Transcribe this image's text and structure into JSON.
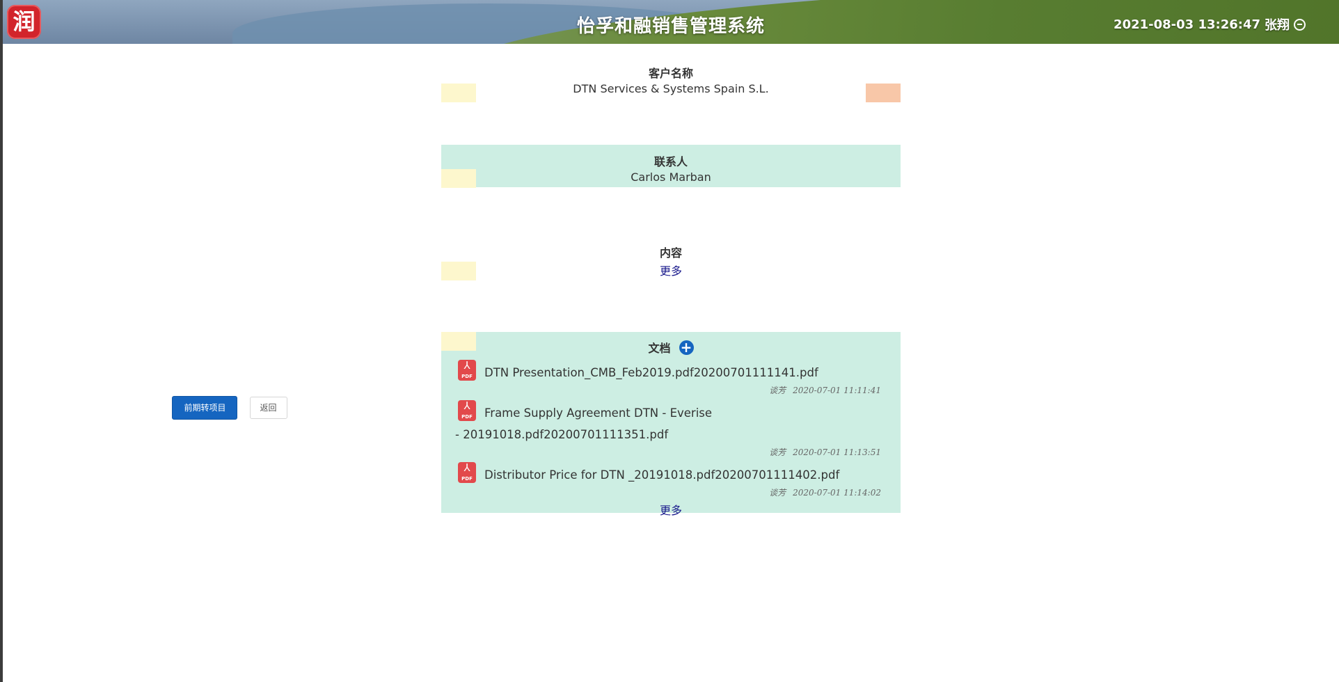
{
  "header": {
    "logo_char": "润",
    "title": "怡孚和融销售管理系统",
    "datetime": "2021-08-03 13:26:47",
    "user": "张翔",
    "logout_icon": "circle-minus-icon"
  },
  "customer": {
    "label": "客户名称",
    "value": "DTN Services & Systems Spain S.L."
  },
  "contact": {
    "label": "联系人",
    "value": "Carlos Marban"
  },
  "content": {
    "label": "内容",
    "more": "更多"
  },
  "documents": {
    "label": "文档",
    "add_icon": "plus-circle-icon",
    "file_icon": "pdf-icon",
    "file_tag": "PDF",
    "items": [
      {
        "name": "DTN Presentation_CMB_Feb2019.pdf20200701111141.pdf",
        "user": "谈芳",
        "time": "2020-07-01 11:11:41"
      },
      {
        "name": "Frame Supply Agreement DTN - Everise - 20191018.pdf20200701111351.pdf",
        "user": "谈芳",
        "time": "2020-07-01 11:13:51"
      },
      {
        "name": "Distributor Price for DTN _20191018.pdf20200701111402.pdf",
        "user": "谈芳",
        "time": "2020-07-01 11:14:02"
      }
    ],
    "more": "更多"
  },
  "actions": {
    "convert": "前期转项目",
    "back": "返回"
  },
  "colors": {
    "accent": "#1565c0",
    "section_green": "#cdeee3",
    "marker_yellow": "#fdf7cd",
    "marker_orange": "#f8c7a8",
    "link": "#1a1a8c"
  }
}
